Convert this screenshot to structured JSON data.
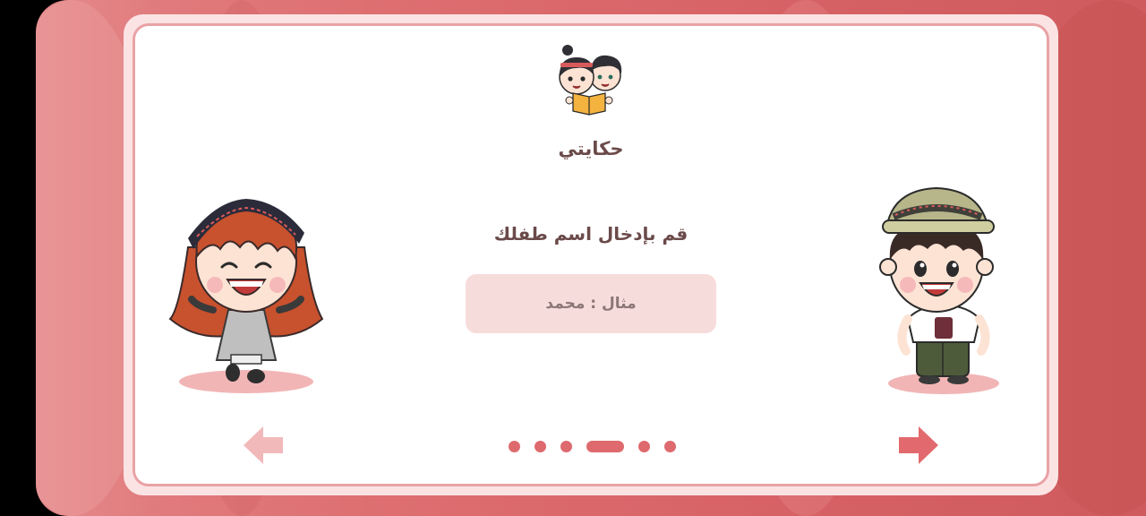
{
  "app": {
    "title": "حكايتي"
  },
  "form": {
    "prompt": "قم بإدخال اسم طفلك",
    "placeholder": "مثال : محمد",
    "value": ""
  },
  "pagination": {
    "total": 6,
    "active_index": 3
  },
  "icons": {
    "logo": "kids-reading-book-logo",
    "prev": "arrow-left-icon",
    "next": "arrow-right-icon"
  },
  "colors": {
    "accent": "#de6a6e",
    "title_text": "#6b4a4a",
    "input_bg": "#f7dcdc",
    "prev_arrow": "#f2b9bb",
    "next_arrow": "#e26a6e"
  }
}
